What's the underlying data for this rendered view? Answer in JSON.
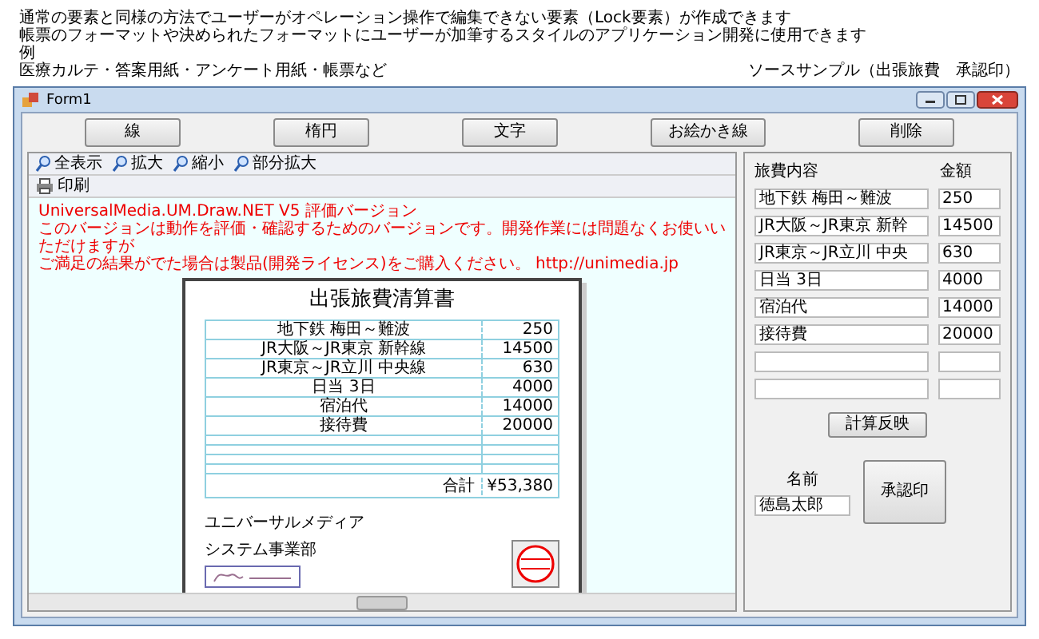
{
  "header": {
    "lines": [
      "通常の要素と同様の方法でユーザーがオペレーション操作で編集できない要素（Lock要素）が作成できます",
      "帳票のフォーマットや決められたフォーマットにユーザーが加筆するスタイルのアプリケーション開発に使用できます",
      "例",
      "医療カルテ・答案用紙・アンケート用紙・帳票など"
    ],
    "caption": "ソースサンプル（出張旅費　承認印）"
  },
  "window": {
    "title": "Form1"
  },
  "buttons": [
    "線",
    "楕円",
    "文字",
    "お絵かき線",
    "削除"
  ],
  "toolbar": [
    "全表示",
    "拡大",
    "縮小",
    "部分拡大"
  ],
  "print_button": "印刷",
  "preview": {
    "notice": [
      "UniversalMedia.UM.Draw.NET V5 評価バージョン",
      "このバージョンは動作を評価・確認するためのバージョンです。開発作業には問題なくお使いいただけますが",
      "ご満足の結果がでた場合は製品(開発ライセンス)をご購入ください。 http://unimedia.jp"
    ],
    "document": {
      "title": "出張旅費清算書",
      "rows": [
        {
          "item": "地下鉄 梅田～難波",
          "amount": "250"
        },
        {
          "item": "JR大阪～JR東京 新幹線",
          "amount": "14500"
        },
        {
          "item": "JR東京～JR立川 中央線",
          "amount": "630"
        },
        {
          "item": "日当 3日",
          "amount": "4000"
        },
        {
          "item": "宿泊代",
          "amount": "14000"
        },
        {
          "item": "接待費",
          "amount": "20000"
        }
      ],
      "total_label": "合計",
      "total": "¥53,380",
      "company": "ユニバーサルメディア",
      "department": "システム事業部"
    }
  },
  "form": {
    "columns": [
      "旅費内容",
      "金額"
    ],
    "rows": [
      {
        "item": "地下鉄 梅田～難波",
        "amount": "250"
      },
      {
        "item": "JR大阪～JR東京 新幹",
        "amount": "14500"
      },
      {
        "item": "JR東京～JR立川 中央",
        "amount": "630"
      },
      {
        "item": "日当 3日",
        "amount": "4000"
      },
      {
        "item": "宿泊代",
        "amount": "14000"
      },
      {
        "item": "接待費",
        "amount": "20000"
      }
    ],
    "calc_button": "計算反映",
    "name_label": "名前",
    "name_value": "徳島太郎",
    "approve_button": "承認印"
  }
}
